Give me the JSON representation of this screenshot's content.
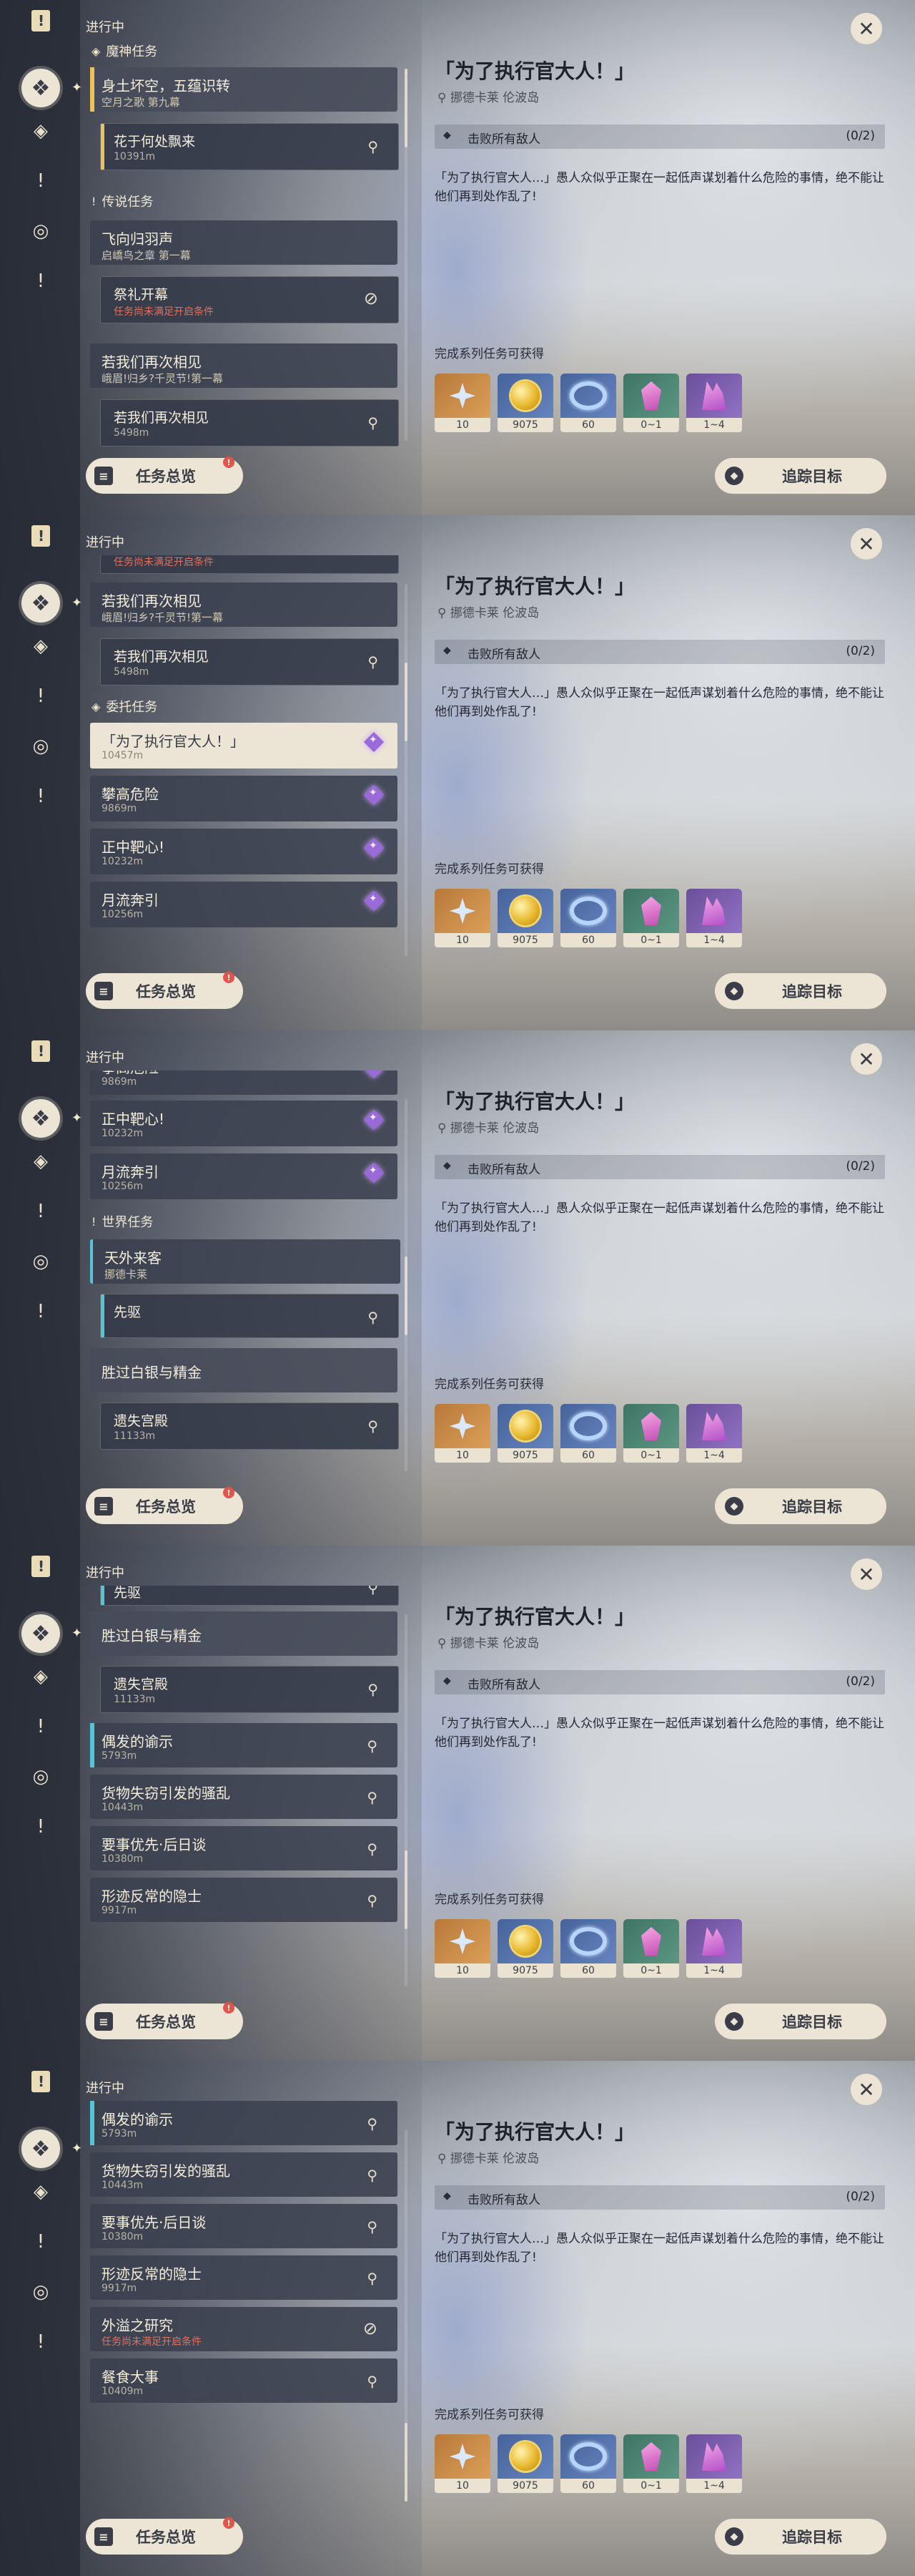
{
  "common": {
    "status": "进行中",
    "overview_label": "任务总览",
    "track_label": "追踪目标",
    "detail": {
      "title": "「为了执行官大人！」",
      "location": "挪德卡莱 伦波岛",
      "objective": "击败所有敌人",
      "objective_count": "(0/2)",
      "description": "「为了执行官大人…」愚人众似乎正聚在一起低声谋划着什么危险的事情，绝不能让他们再到处作乱了!",
      "reward_label": "完成系列任务可获得"
    },
    "rewards": [
      {
        "icon": "primogem-icon",
        "count": "10",
        "tone": "gold"
      },
      {
        "icon": "mora-icon",
        "count": "9075",
        "tone": "blue"
      },
      {
        "icon": "adventure-exp-icon",
        "count": "60",
        "tone": "blue"
      },
      {
        "icon": "crystal-ore-icon",
        "count": "0~1",
        "tone": "green"
      },
      {
        "icon": "purple-crystal-icon",
        "count": "1~4",
        "tone": "purple"
      }
    ]
  },
  "frames": [
    {
      "sections": {
        "archon": "魔神任务",
        "legend": "传说任务"
      },
      "items": {
        "c1_title": "身土坏空，五蕴识转",
        "c1_sub": "空月之歌 第九幕",
        "s1_title": "花于何处飘来",
        "s1_dist": "10391m",
        "c2_title": "飞向归羽声",
        "c2_sub": "启嶠鸟之章 第一幕",
        "s2_title": "祭礼开幕",
        "s2_warn": "任务尚未满足开启条件",
        "c3_title": "若我们再次相见",
        "c3_sub": "峨眉!归乡?千灵节!第一幕",
        "s3_title": "若我们再次相见",
        "s3_dist": "5498m"
      }
    },
    {
      "sections": {
        "commission": "委托任务"
      },
      "items": {
        "s0_warn": "任务尚未满足开启条件",
        "c1_title": "若我们再次相见",
        "c1_sub": "峨眉!归乡?千灵节!第一幕",
        "s1_title": "若我们再次相见",
        "s1_dist": "5498m",
        "q1_title": "「为了执行官大人！」",
        "q1_dist": "10457m",
        "q2_title": "攀高危险",
        "q2_dist": "9869m",
        "q3_title": "正中靶心!",
        "q3_dist": "10232m",
        "q4_title": "月流奔引",
        "q4_dist": "10256m"
      }
    },
    {
      "sections": {
        "world": "世界任务"
      },
      "items": {
        "q0_title": "攀高危险",
        "q0_dist": "9869m",
        "q1_title": "正中靶心!",
        "q1_dist": "10232m",
        "q2_title": "月流奔引",
        "q2_dist": "10256m",
        "c1_title": "天外来客",
        "c1_sub": "挪德卡莱",
        "s1_title": "先驱",
        "c2_title": "胜过白银与精金",
        "s2_title": "遗失宫殿",
        "s2_dist": "11133m"
      }
    },
    {
      "items": {
        "s0_title": "先驱",
        "c1_title": "胜过白银与精金",
        "s1_title": "遗失宫殿",
        "s1_dist": "11133m",
        "q1_title": "偶发的谕示",
        "q1_dist": "5793m",
        "q2_title": "货物失窃引发的骚乱",
        "q2_dist": "10443m",
        "q3_title": "要事优先·后日谈",
        "q3_dist": "10380m",
        "q4_title": "形迹反常的隐士",
        "q4_dist": "9917m"
      }
    },
    {
      "items": {
        "q1_title": "偶发的谕示",
        "q1_dist": "5793m",
        "q2_title": "货物失窃引发的骚乱",
        "q2_dist": "10443m",
        "q3_title": "要事优先·后日谈",
        "q3_dist": "10380m",
        "q4_title": "形迹反常的隐士",
        "q4_dist": "9917m",
        "q5_title": "外溢之研究",
        "q5_warn": "任务尚未满足开启条件",
        "q6_title": "餐食大事",
        "q6_dist": "10409m"
      }
    }
  ]
}
